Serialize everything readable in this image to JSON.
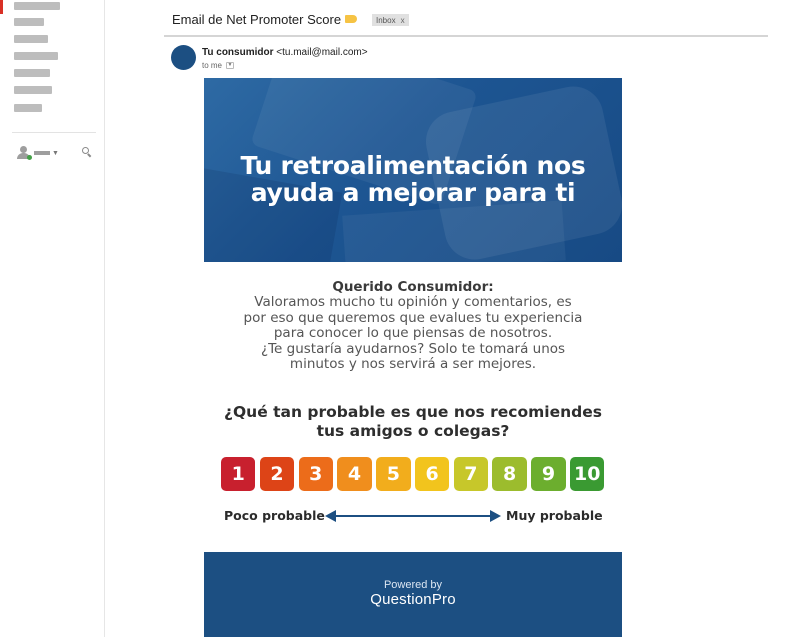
{
  "email": {
    "subject": "Email de Net Promoter Score",
    "label": "Inbox",
    "label_close": "x",
    "sender_name": "Tu consumidor",
    "sender_email": "<tu.mail@mail.com>",
    "to": "to me"
  },
  "content": {
    "hero_title_line1": "Tu retroalimentación nos",
    "hero_title_line2": "ayuda a mejorar para ti",
    "greeting": "Querido Consumidor:",
    "body_lines": [
      "Valoramos mucho tu opinión y comentarios, es",
      "por eso que queremos que evalues tu experiencia",
      "para conocer lo que piensas de nosotros.",
      "¿Te gustaría ayudarnos? Solo te tomará unos",
      "minutos y nos servirá a ser mejores."
    ],
    "question_line1": "¿Qué tan probable es que nos recomiendes",
    "question_line2": "tus amigos o colegas?",
    "scale": [
      {
        "label": "1",
        "color": "#c8202e"
      },
      {
        "label": "2",
        "color": "#dd4417"
      },
      {
        "label": "3",
        "color": "#ec6c1a"
      },
      {
        "label": "4",
        "color": "#f08e1d"
      },
      {
        "label": "5",
        "color": "#f2ad1c"
      },
      {
        "label": "6",
        "color": "#f2c41d"
      },
      {
        "label": "7",
        "color": "#c7c72a"
      },
      {
        "label": "8",
        "color": "#9cbc2d"
      },
      {
        "label": "9",
        "color": "#6cae2e"
      },
      {
        "label": "10",
        "color": "#3a9a32"
      }
    ],
    "left_label": "Poco probable",
    "right_label": "Muy probable",
    "powered_by": "Powered by",
    "brand": "QuestionPro"
  },
  "colors": {
    "brand_blue": "#1c4f82",
    "arrow": "#1c4f82"
  }
}
